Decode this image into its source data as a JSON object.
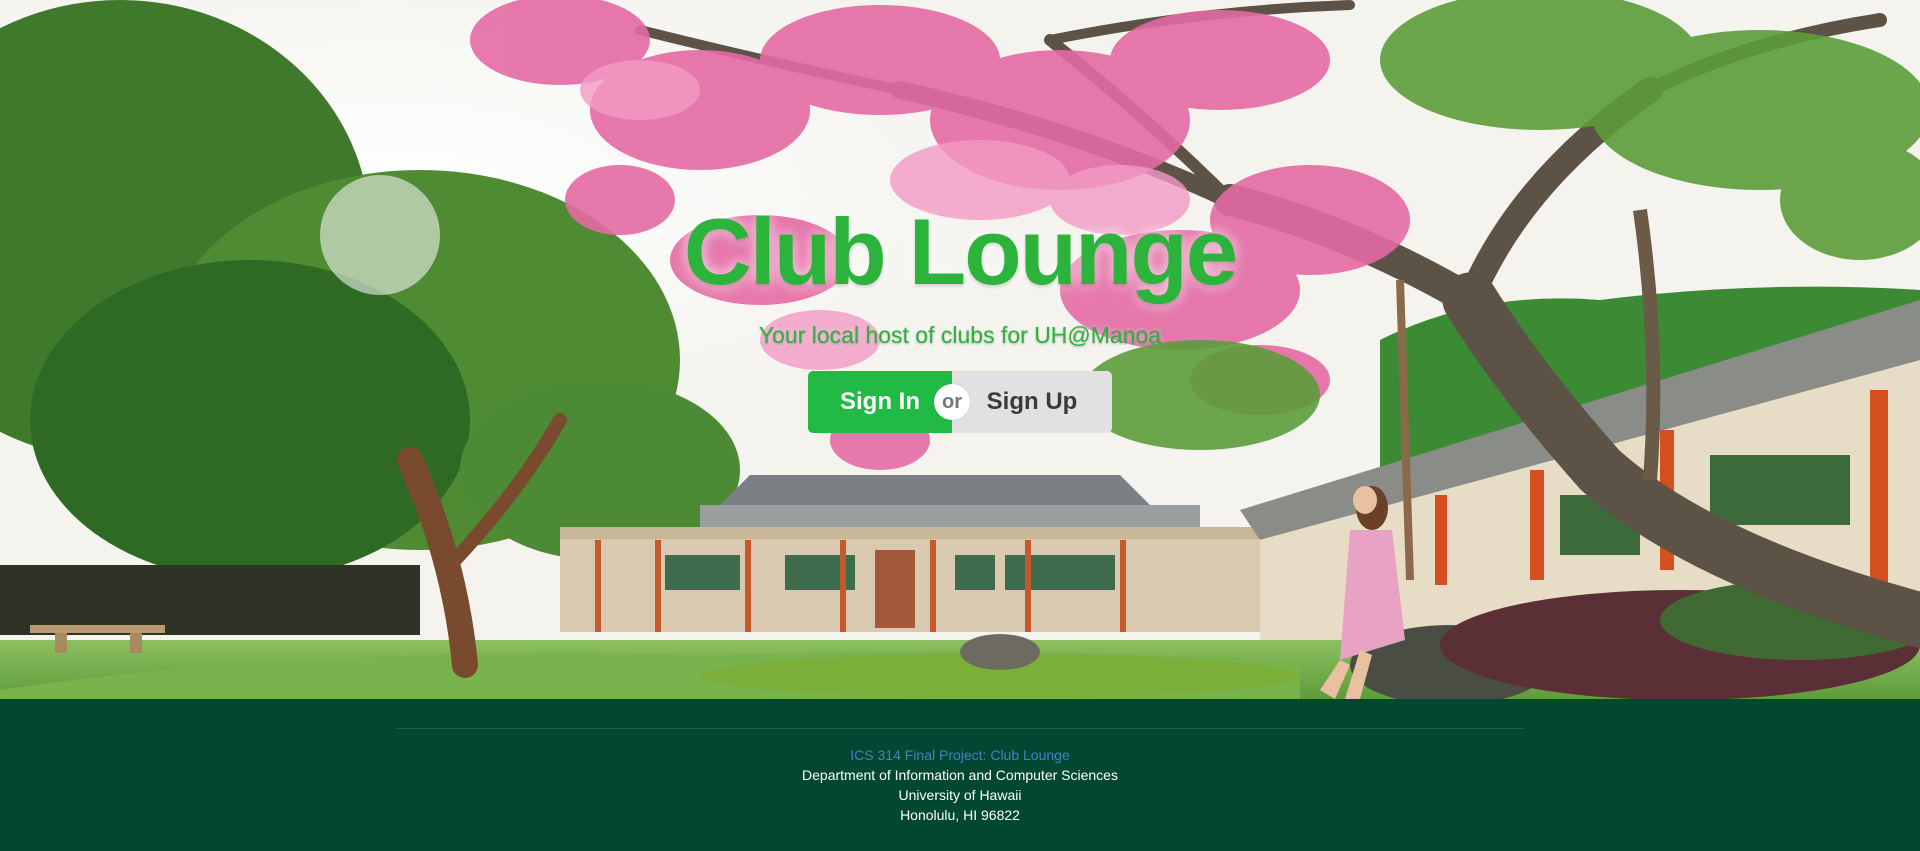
{
  "hero": {
    "title": "Club Lounge",
    "subtitle": "Your local host of clubs for UH@Manoa",
    "signin_label": "Sign In",
    "or_label": "or",
    "signup_label": "Sign Up"
  },
  "footer": {
    "project_link": "ICS 314 Final Project: Club Lounge",
    "department": "Department of Information and Computer Sciences",
    "university": "University of Hawaii",
    "address": "Honolulu, HI 96822"
  },
  "colors": {
    "brand_green": "#2bb33b",
    "signin_button": "#21ba45",
    "signup_button": "#e0e1e2",
    "footer_bg": "#024731",
    "link": "#4183c4"
  }
}
